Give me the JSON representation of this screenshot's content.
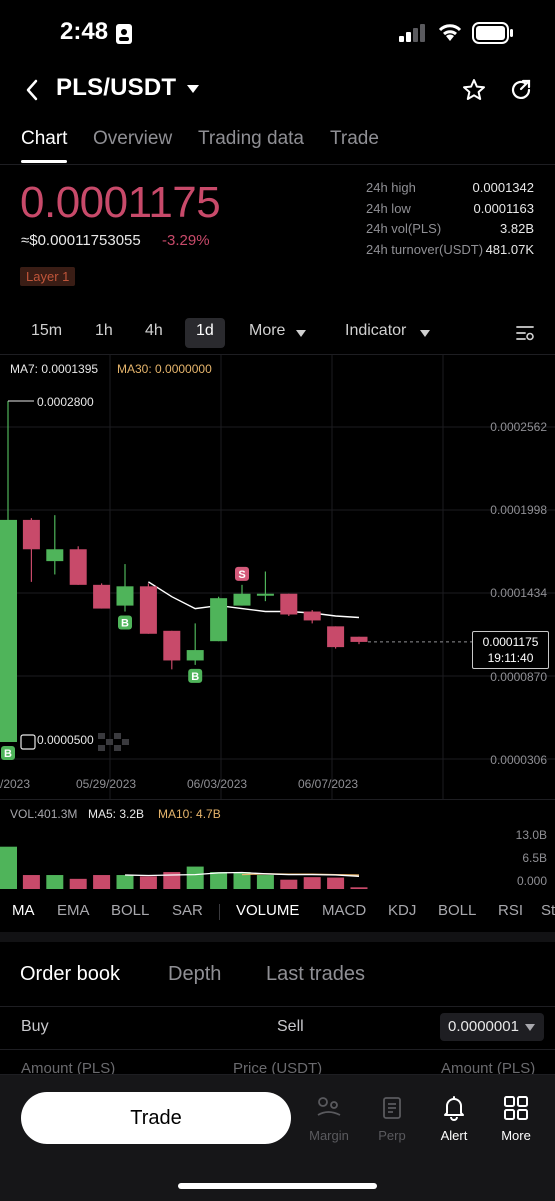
{
  "status_bar": {
    "time": "2:48"
  },
  "header": {
    "pair": "PLS/USDT"
  },
  "tabs": [
    "Chart",
    "Overview",
    "Trading data",
    "Trade"
  ],
  "ticker": {
    "price": "0.0001175",
    "fiat_price": "≈$0.00011753055",
    "change_pct": "-3.29%",
    "tag": "Layer 1",
    "stats": [
      {
        "label": "24h high",
        "value": "0.0001342"
      },
      {
        "label": "24h low",
        "value": "0.0001163"
      },
      {
        "label": "24h vol(PLS)",
        "value": "3.82B"
      },
      {
        "label": "24h turnover(USDT)",
        "value": "481.07K"
      }
    ]
  },
  "timeframes": [
    "15m",
    "1h",
    "4h",
    "1d",
    "More",
    "Indicator"
  ],
  "chart_legend": {
    "ma7": "MA7: 0.0001395",
    "ma30": "MA30: 0.0000000"
  },
  "chart_data": {
    "type": "candlestick",
    "y_axis_labels": [
      "0.0002562",
      "0.0001998",
      "0.0001434",
      "0.0000870",
      "0.0000306"
    ],
    "x_axis_labels": [
      "/2023",
      "05/29/2023",
      "06/03/2023",
      "06/07/2023"
    ],
    "high_marker": "0.0002800",
    "low_marker": "0.0000500",
    "current_price_label": "0.0001175",
    "countdown": "19:11:40",
    "signals": [
      {
        "candle": 0,
        "label": "B"
      },
      {
        "candle": 5,
        "label": "B"
      },
      {
        "candle": 8,
        "label": "B"
      },
      {
        "candle": 10,
        "label": "S"
      }
    ],
    "candles": [
      {
        "o": 5e-05,
        "h": 0.00028,
        "l": 5e-05,
        "c": 0.0001998
      },
      {
        "o": 0.0001998,
        "h": 0.000201,
        "l": 0.000158,
        "c": 0.00018
      },
      {
        "o": 0.000172,
        "h": 0.000203,
        "l": 0.000163,
        "c": 0.00018
      },
      {
        "o": 0.00018,
        "h": 0.000182,
        "l": 0.000156,
        "c": 0.000156
      },
      {
        "o": 0.000156,
        "h": 0.000157,
        "l": 0.00014,
        "c": 0.00014
      },
      {
        "o": 0.000142,
        "h": 0.00017,
        "l": 0.000138,
        "c": 0.000155
      },
      {
        "o": 0.000155,
        "h": 0.000157,
        "l": 0.000123,
        "c": 0.000123
      },
      {
        "o": 0.000125,
        "h": 0.000125,
        "l": 9.9e-05,
        "c": 0.000105
      },
      {
        "o": 0.000105,
        "h": 0.00013,
        "l": 0.000102,
        "c": 0.000112
      },
      {
        "o": 0.000118,
        "h": 0.000148,
        "l": 0.000118,
        "c": 0.000147
      },
      {
        "o": 0.000142,
        "h": 0.000156,
        "l": 0.000142,
        "c": 0.00015
      },
      {
        "o": 0.00015,
        "h": 0.000165,
        "l": 0.000145,
        "c": 0.00015
      },
      {
        "o": 0.00015,
        "h": 0.00015,
        "l": 0.000135,
        "c": 0.000136
      },
      {
        "o": 0.000138,
        "h": 0.000139,
        "l": 0.00013,
        "c": 0.000132
      },
      {
        "o": 0.000128,
        "h": 0.000128,
        "l": 0.000113,
        "c": 0.000114
      },
      {
        "o": 0.000121,
        "h": 0.000121,
        "l": 0.000116,
        "c": 0.0001175
      }
    ],
    "ma_line": [
      null,
      null,
      null,
      null,
      null,
      null,
      0.000158,
      0.000148,
      0.00014,
      0.000142,
      0.00014,
      0.000138,
      0.000138,
      0.000137,
      0.000135,
      0.000134
    ],
    "volume": {
      "legend": {
        "vol": "VOL:401.3M",
        "ma5": "MA5: 3.2B",
        "ma10": "MA10: 4.7B"
      },
      "axis_labels": [
        "13.0B",
        "6.5B",
        "0.000"
      ],
      "values": [
        10.0,
        3.3,
        3.3,
        2.4,
        3.3,
        3.3,
        3.0,
        4.0,
        5.3,
        4.0,
        4.0,
        3.3,
        2.2,
        2.8,
        2.7,
        0.4
      ],
      "ma5": [
        null,
        null,
        null,
        null,
        null,
        3.3,
        3.2,
        3.3,
        3.4,
        3.8,
        3.9,
        3.6,
        3.4,
        3.4,
        3.3,
        3.0
      ],
      "ma10": [
        null,
        null,
        null,
        null,
        null,
        null,
        null,
        null,
        null,
        null,
        3.4,
        3.6,
        3.5,
        3.5,
        3.4,
        3.3
      ]
    }
  },
  "indicators": [
    "MA",
    "EMA",
    "BOLL",
    "SAR",
    "VOLUME",
    "MACD",
    "KDJ",
    "BOLL",
    "RSI",
    "St"
  ],
  "orderbook": {
    "tabs": [
      "Order book",
      "Depth",
      "Last trades"
    ],
    "buy_label": "Buy",
    "sell_label": "Sell",
    "precision": "0.0000001",
    "col_amount": "Amount (PLS)",
    "col_price": "Price (USDT)",
    "col_amount2": "Amount (PLS)"
  },
  "bottom_nav": {
    "trade_button": "Trade",
    "items": [
      "Margin",
      "Perp",
      "Alert",
      "More"
    ]
  },
  "colors": {
    "up": "#4fb45a",
    "down": "#c84a6a",
    "ma_white": "#ffffff",
    "ma_yellow": "#e6b56c"
  }
}
